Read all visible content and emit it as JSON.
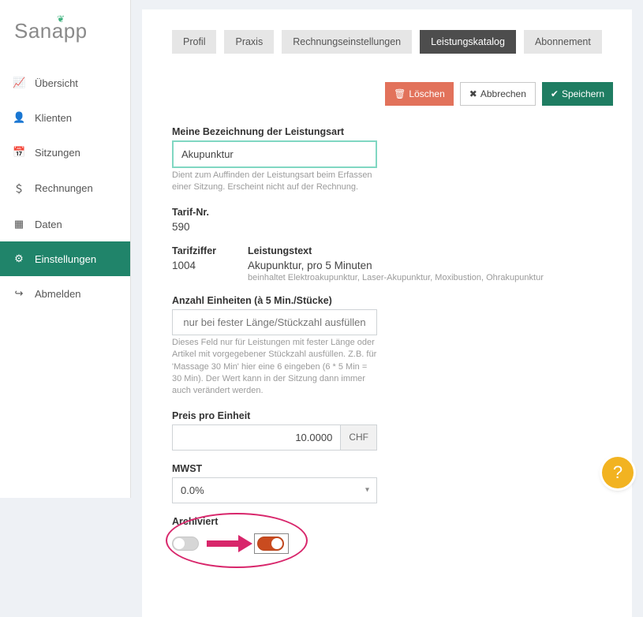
{
  "brand": {
    "name": "Sanapp"
  },
  "sidebar": {
    "items": [
      {
        "label": "Übersicht",
        "icon": "📈"
      },
      {
        "label": "Klienten",
        "icon": "👤"
      },
      {
        "label": "Sitzungen",
        "icon": "📅"
      },
      {
        "label": "Rechnungen",
        "icon": "＄"
      },
      {
        "label": "Daten",
        "icon": "▦"
      },
      {
        "label": "Einstellungen",
        "icon": "⚙"
      },
      {
        "label": "Abmelden",
        "icon": "↪"
      }
    ],
    "active_index": 5
  },
  "tabs": {
    "items": [
      "Profil",
      "Praxis",
      "Rechnungseinstellungen",
      "Leistungskatalog",
      "Abonnement"
    ],
    "active_index": 3
  },
  "actions": {
    "delete": "Löschen",
    "cancel": "Abbrechen",
    "save": "Speichern"
  },
  "form": {
    "bezeichnung": {
      "label": "Meine Bezeichnung der Leistungsart",
      "value": "Akupunktur",
      "help": "Dient zum Auffinden der Leistungsart beim Erfassen einer Sitzung. Erscheint nicht auf der Rechnung."
    },
    "tarif_nr": {
      "label": "Tarif-Nr.",
      "value": "590"
    },
    "tarifziffer": {
      "label": "Tarifziffer",
      "value": "1004"
    },
    "leistungstext": {
      "label": "Leistungstext",
      "value": "Akupunktur, pro 5 Minuten",
      "sub": "beinhaltet Elektroakupunktur, Laser-Akupunktur, Moxibustion, Ohrakupunktur"
    },
    "einheiten": {
      "label": "Anzahl Einheiten (à 5 Min./Stücke)",
      "placeholder": "nur bei fester Länge/Stückzahl ausfüllen",
      "help": "Dieses Feld nur für Leistungen mit fester Länge oder Artikel mit vorgegebener Stückzahl ausfüllen. Z.B. für 'Massage 30 Min' hier eine 6 eingeben (6 * 5 Min = 30 Min). Der Wert kann in der Sitzung dann immer auch verändert werden."
    },
    "preis": {
      "label": "Preis pro Einheit",
      "value": "10.0000",
      "currency": "CHF"
    },
    "mwst": {
      "label": "MWST",
      "value": "0.0%"
    },
    "archiv": {
      "label": "Archiviert"
    }
  },
  "help_fab": "?"
}
